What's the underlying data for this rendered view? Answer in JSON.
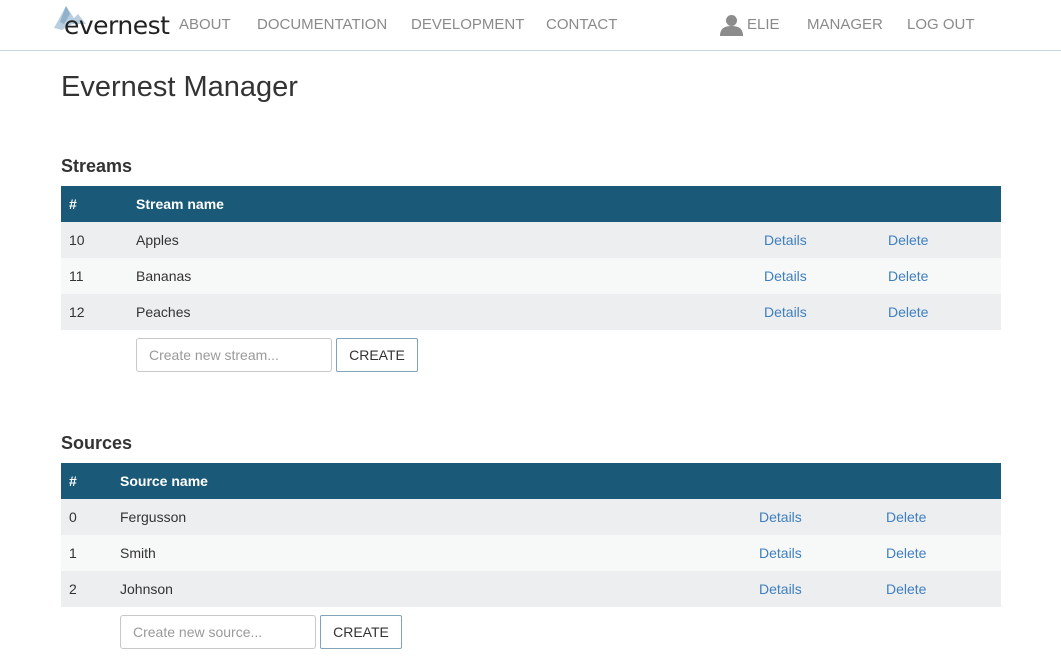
{
  "navbar": {
    "brand": "evernest",
    "links": [
      "About",
      "Documentation",
      "Development",
      "Contact"
    ],
    "user": "Elie",
    "manager": "Manager",
    "logout": "Log out"
  },
  "page_title": "Evernest Manager",
  "streams": {
    "title": "Streams",
    "headers": [
      "#",
      "Stream name"
    ],
    "rows": [
      {
        "id": "10",
        "name": "Apples",
        "details": "Details",
        "delete": "Delete"
      },
      {
        "id": "11",
        "name": "Bananas",
        "details": "Details",
        "delete": "Delete"
      },
      {
        "id": "12",
        "name": "Peaches",
        "details": "Details",
        "delete": "Delete"
      }
    ],
    "placeholder": "Create new stream...",
    "create_label": "Create"
  },
  "sources": {
    "title": "Sources",
    "headers": [
      "#",
      "Source name"
    ],
    "rows": [
      {
        "id": "0",
        "name": "Fergusson",
        "details": "Details",
        "delete": "Delete"
      },
      {
        "id": "1",
        "name": "Smith",
        "details": "Details",
        "delete": "Delete"
      },
      {
        "id": "2",
        "name": "Johnson",
        "details": "Details",
        "delete": "Delete"
      }
    ],
    "placeholder": "Create new source...",
    "create_label": "Create"
  },
  "colors": {
    "header_bg": "#1a5a78",
    "link": "#3f7fc0"
  }
}
